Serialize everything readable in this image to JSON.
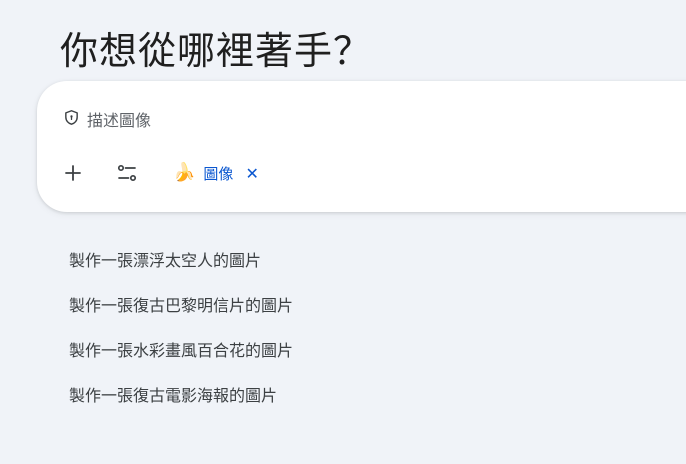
{
  "headline": "你想從哪裡著手？",
  "composer": {
    "placeholder": "描述圖像",
    "placeholder_icon": "shield-icon",
    "tools": [
      {
        "name": "add-button",
        "icon": "plus-icon"
      },
      {
        "name": "tools-button",
        "icon": "sliders-icon"
      }
    ],
    "chip": {
      "emoji": "🍌",
      "label": "圖像",
      "close": "✕"
    }
  },
  "suggestions": [
    "製作一張漂浮太空人的圖片",
    "製作一張復古巴黎明信片的圖片",
    "製作一張水彩畫風百合花的圖片",
    "製作一張復古電影海報的圖片"
  ],
  "colors": {
    "background": "#f0f3f8",
    "card": "#ffffff",
    "accent": "#0b57d0",
    "text": "#1f1f1f",
    "muted": "#5f6368"
  }
}
